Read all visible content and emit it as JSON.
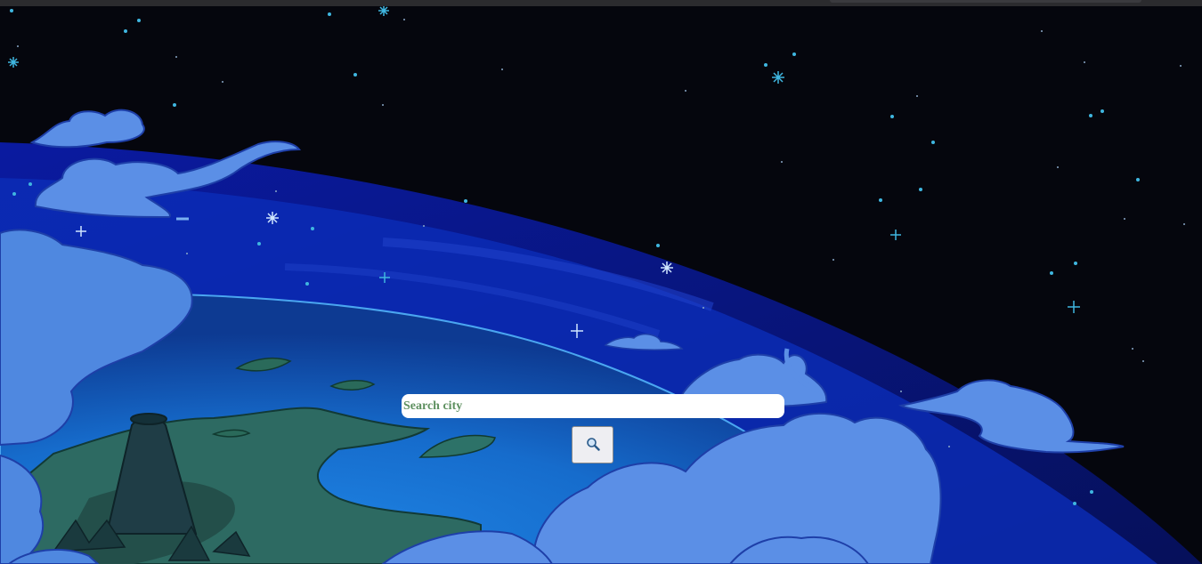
{
  "search": {
    "placeholder": "Search city",
    "value": "",
    "button_icon": "magnifying-glass-icon"
  },
  "background": {
    "description_icon": "space-earth-illustration",
    "sky_color": "#05060d",
    "ocean_color": "#1a6fd0",
    "cloud_color": "#5b8fe6",
    "land_color": "#2d6a62"
  }
}
